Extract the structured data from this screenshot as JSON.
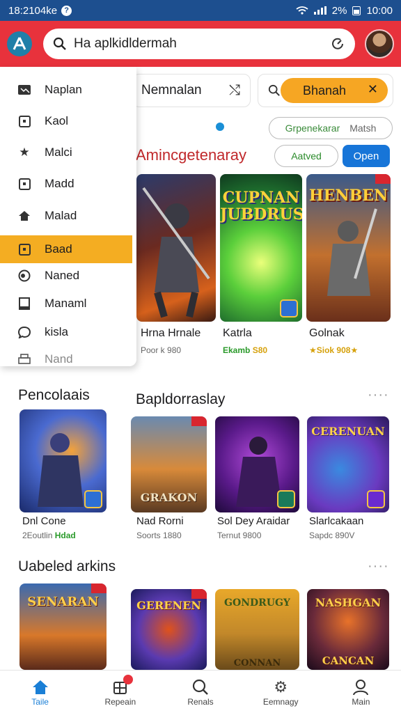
{
  "status_bar": {
    "time_left": "18:2104ke",
    "battery": "2%",
    "time_right": "10:00"
  },
  "app_bar": {
    "search_value": "Ha apl‌kidldermah"
  },
  "drawer": {
    "items": [
      {
        "label": "Naplan",
        "icon": "folder-icon"
      },
      {
        "label": "Kaol",
        "icon": "calendar-icon"
      },
      {
        "label": "Malci",
        "icon": "star-icon"
      },
      {
        "label": "Madd",
        "icon": "bookmark-box-icon"
      },
      {
        "label": "Malad",
        "icon": "home-icon"
      },
      {
        "label": "Baad",
        "icon": "square-icon",
        "active": true
      },
      {
        "label": "Naned",
        "icon": "disc-icon"
      },
      {
        "label": "Manaml",
        "icon": "book-icon"
      },
      {
        "label": "kisla",
        "icon": "chat-icon"
      },
      {
        "label": "Nand",
        "icon": "printer-icon"
      }
    ]
  },
  "filter": {
    "left_label": "Nemnalan",
    "orange_label": "Bhanah",
    "chip1": "Grpenekarar",
    "chip1b": "Matsh",
    "chip2": "Aatved",
    "chip3": "Open"
  },
  "sections": {
    "s1": {
      "title": "Amincgetenaray"
    },
    "s2": {
      "title": "Pencolaais"
    },
    "s3": {
      "title": "Bapldorraslay"
    },
    "s4": {
      "title": "Uabeled arkins"
    }
  },
  "cards_row1": [
    {
      "name": "Hrna Hrnale",
      "meta": "Poor k 980",
      "art": ""
    },
    {
      "name": "Katrla",
      "meta_green": "Ekamb",
      "meta_rest": " S80",
      "art": "CUPNAN JUBDRUS"
    },
    {
      "name": "Golnak",
      "meta_yellow": "★Siok 908★",
      "art": "HENBEN"
    }
  ],
  "cards_row2": [
    {
      "name": "Dnl Cone",
      "meta": "2Eoutlin",
      "meta_green": "Hdad"
    },
    {
      "name": "Nad Rorni",
      "meta": "Soorts 1880",
      "art": "GRAKON"
    },
    {
      "name": "Sol Dey Araidar",
      "meta": "Ternut 9800"
    },
    {
      "name": "Slarlcakaan",
      "meta": "Sapdc 890V",
      "art": "CERENUAN"
    }
  ],
  "cards_row3": [
    {
      "art": "SENARAN"
    },
    {
      "art": "GERENEN"
    },
    {
      "art": "GONDRUGY",
      "art2": "CONNAN"
    },
    {
      "art": "NASHGAN",
      "art2": "CANCAN"
    }
  ],
  "bottom_nav": [
    {
      "label": "Taile",
      "icon": "home-icon",
      "active": true
    },
    {
      "label": "Repeain",
      "icon": "puzzle-icon"
    },
    {
      "label": "Renals",
      "icon": "search-icon"
    },
    {
      "label": "Eemnagy",
      "icon": "gear-icon"
    },
    {
      "label": "Main",
      "icon": "user-icon"
    }
  ]
}
